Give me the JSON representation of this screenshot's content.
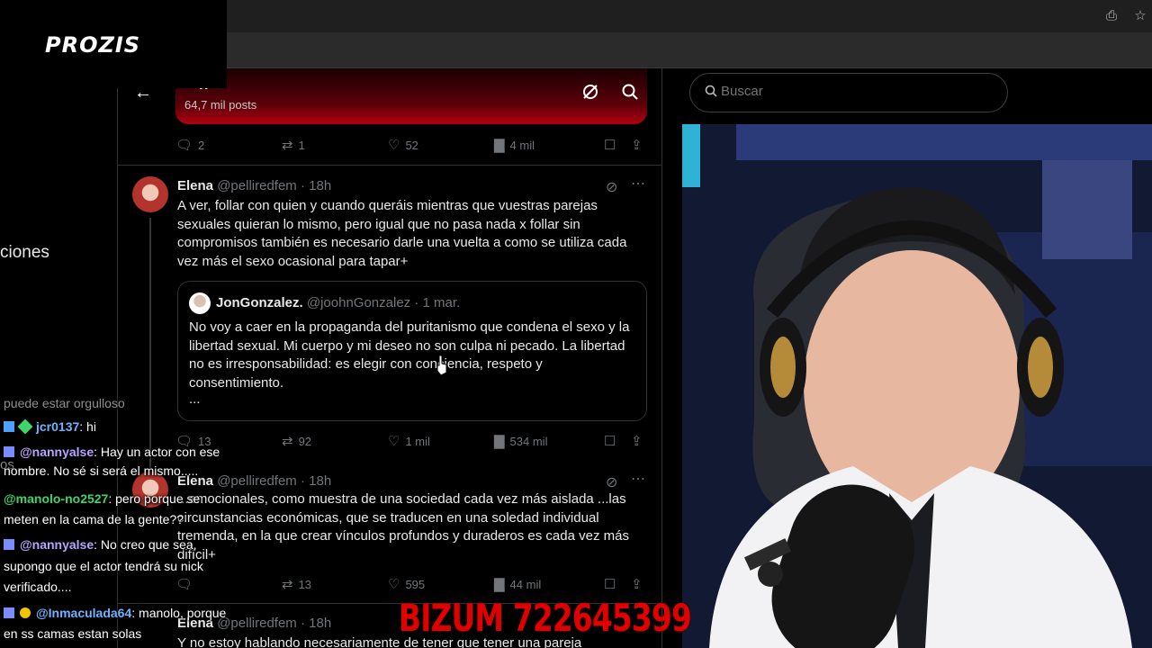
{
  "logo": {
    "text": "PROZIS"
  },
  "side": {
    "nav_label_partial": "ciones",
    "lower_label_partial": "os"
  },
  "header": {
    "title_partial": "n",
    "posts_count": "64,7 mil posts",
    "icons": [
      "back-arrow-icon",
      "grok-icon",
      "search-icon"
    ]
  },
  "prev_post_stats": {
    "replies": "2",
    "reposts": "1",
    "likes": "52",
    "views": "4 mil"
  },
  "tweets": [
    {
      "name": "Elena",
      "handle": "@pelliredfem",
      "time": "· 18h",
      "text": "A ver, follar con quien y cuando queráis mientras que vuestras parejas sexuales quieran lo mismo, pero igual que no pasa nada x follar sin compromisos también es necesario darle una vuelta a como se utiliza cada vez más el sexo ocasional para tapar+",
      "quote": {
        "name": "JonGonzalez.",
        "handle": "@joohnGonzalez",
        "time": "· 1 mar.",
        "text": "No voy a caer en la propaganda  del puritanismo que condena el sexo y la libertad sexual. Mi cuerpo y mi deseo no son culpa ni pecado. La libertad no es irresponsabilidad: es elegir con conciencia, respeto y consentimiento.",
        "more": "..."
      },
      "stats": {
        "replies": "13",
        "reposts": "92",
        "likes": "1 mil",
        "views": "534 mil"
      }
    },
    {
      "name": "Elena",
      "handle": "@pelliredfem",
      "time": "· 18h",
      "text": "...emocionales, como muestra de una sociedad cada vez más aislada ...las circunstancias económicas, que se traducen en una soledad individual tremenda, en la que crear vínculos profundos y duraderos es cada vez más difícil+",
      "stats": {
        "replies": "",
        "reposts": "13",
        "likes": "595",
        "views": "44 mil"
      }
    },
    {
      "name": "Elena",
      "handle": "@pelliredfem",
      "time": "· 18h",
      "text": "Y no estoy hablando necesariamente de tener que tener una pareja"
    }
  ],
  "search": {
    "placeholder": "Buscar"
  },
  "chat": [
    {
      "user": "",
      "text": "puede estar orgulloso"
    },
    {
      "user": "jcr0137",
      "text": ": hi"
    },
    {
      "user": "@nannyalse",
      "text": ": Hay un actor con ese"
    },
    {
      "user": "",
      "text": "nombre. No sé si será el mismo....."
    },
    {
      "user": "@manolo-no2527",
      "text": ": pero porque se"
    },
    {
      "user": "",
      "text": "meten en la cama de la gente??"
    },
    {
      "user": "@nannyalse",
      "text": ": No creo que sea,"
    },
    {
      "user": "",
      "text": "supongo que el actor tendrá su nick"
    },
    {
      "user": "",
      "text": "verificado...."
    },
    {
      "user": "@Inmaculada64",
      "text": ": manolo, porque"
    },
    {
      "user": "",
      "text": "en ss camas estan solas"
    }
  ],
  "bizum": "BIZUM 722645399",
  "colors": {
    "accent_red": "#e00000",
    "chat_purple": "#b9a3ff",
    "chat_green": "#3fd46a",
    "chat_blue": "#6fb3ff"
  }
}
